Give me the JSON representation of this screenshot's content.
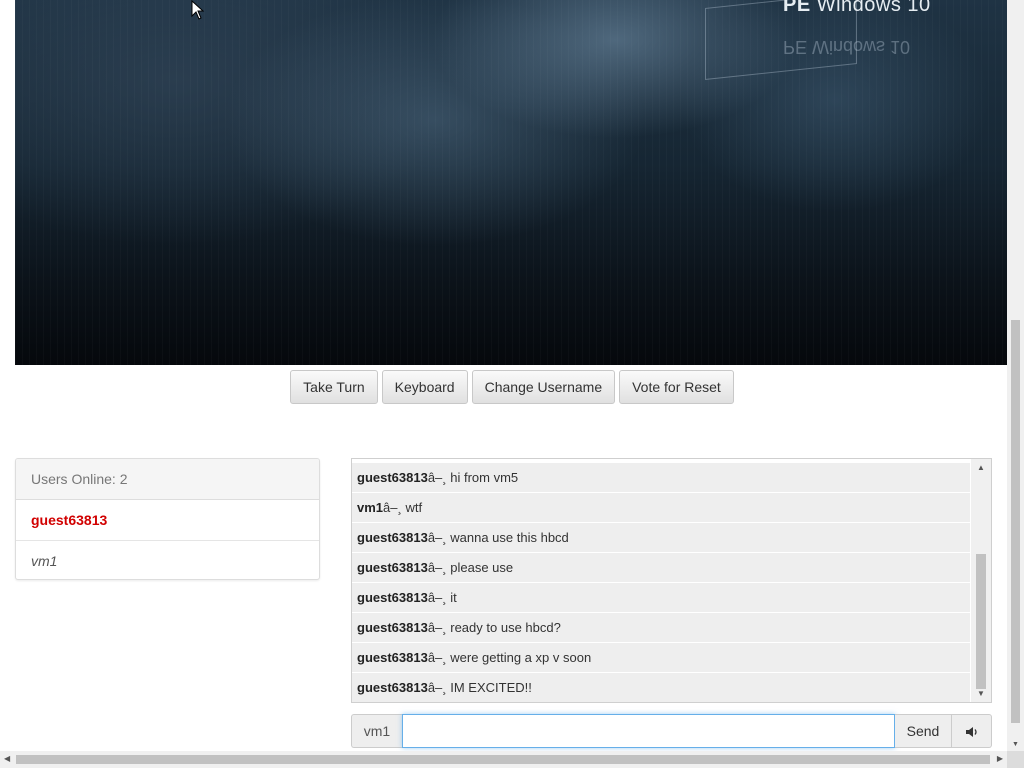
{
  "vm_screen": {
    "logo_bold": "PE",
    "logo_text": "Windows 10",
    "logo_mirror": "PE Windows 10"
  },
  "toolbar": {
    "take_turn": "Take Turn",
    "keyboard": "Keyboard",
    "change_username": "Change Username",
    "vote_reset": "Vote for Reset"
  },
  "users": {
    "header": "Users Online: 2",
    "list": [
      {
        "name": "guest63813",
        "is_self": true
      },
      {
        "name": "vm1",
        "is_self": false
      }
    ]
  },
  "chat": {
    "separator": "â–¸",
    "messages": [
      {
        "user": "guest63813",
        "text": "hi from vm5"
      },
      {
        "user": "vm1",
        "text": "wtf"
      },
      {
        "user": "guest63813",
        "text": "wanna use this hbcd"
      },
      {
        "user": "guest63813",
        "text": "please use"
      },
      {
        "user": "guest63813",
        "text": "it"
      },
      {
        "user": "guest63813",
        "text": "ready to use hbcd?"
      },
      {
        "user": "guest63813",
        "text": "were getting a xp v soon"
      },
      {
        "user": "guest63813",
        "text": "IM EXCITED!!"
      }
    ]
  },
  "input": {
    "username_label": "vm1",
    "value": "",
    "send_label": "Send",
    "sound_icon": "speaker-icon"
  },
  "colors": {
    "self_user": "#d10000",
    "focus_border": "#66afe9"
  }
}
